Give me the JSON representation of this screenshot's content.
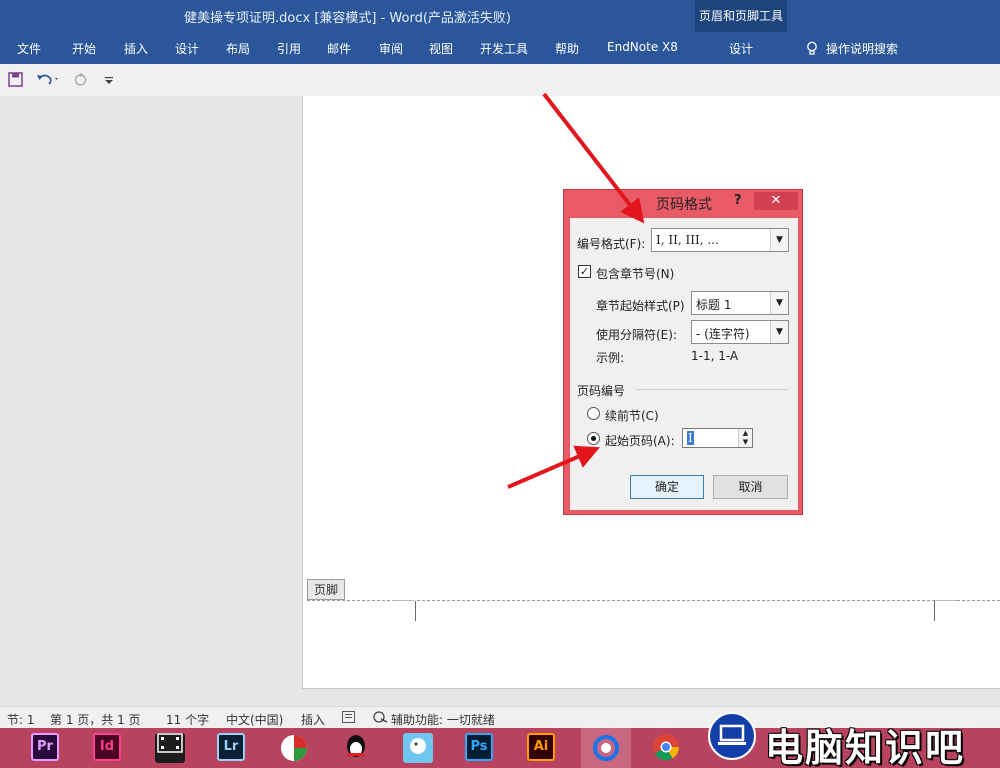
{
  "window": {
    "title": "健美操专项证明.docx [兼容模式]  -  Word(产品激活失败)",
    "context_group": "页眉和页脚工具"
  },
  "ribbon": {
    "tabs": [
      "文件",
      "开始",
      "插入",
      "设计",
      "布局",
      "引用",
      "邮件",
      "审阅",
      "视图",
      "开发工具",
      "帮助",
      "EndNote X8"
    ],
    "context_tab": "设计",
    "tell_me": "操作说明搜索"
  },
  "document": {
    "footer_label": "页脚"
  },
  "dialog": {
    "title": "页码格式",
    "help": "?",
    "close": "✕",
    "number_format_label": "编号格式(F):",
    "number_format_value": "I, II, III, ...",
    "include_chapter_label": "包含章节号(N)",
    "include_chapter_checked": true,
    "chapter_style_label": "章节起始样式(P)",
    "chapter_style_value": "标题 1",
    "separator_label": "使用分隔符(E):",
    "separator_value": "-  (连字符)",
    "example_label": "示例:",
    "example_value": "1-1, 1-A",
    "page_numbering_label": "页码编号",
    "continue_label": "续前节(C)",
    "start_at_label": "起始页码(A):",
    "start_at_value": "I",
    "start_at_selected": true,
    "ok_label": "确定",
    "cancel_label": "取消"
  },
  "statusbar": {
    "section": "节: 1",
    "page": "第 1 页，共 1 页",
    "words": "11 个字",
    "language": "中文(中国)",
    "mode": "插入",
    "accessibility": "辅助功能: 一切就绪"
  },
  "taskbar": {
    "apps": [
      "Pr",
      "Id",
      "Lr",
      "Ps",
      "Ai"
    ],
    "watermark": "电脑知识吧"
  },
  "colors": {
    "ribbon_blue": "#2b579a",
    "dialog_border": "#e85a66",
    "taskbar": "#b8435f",
    "arrow_red": "#e3161d"
  }
}
